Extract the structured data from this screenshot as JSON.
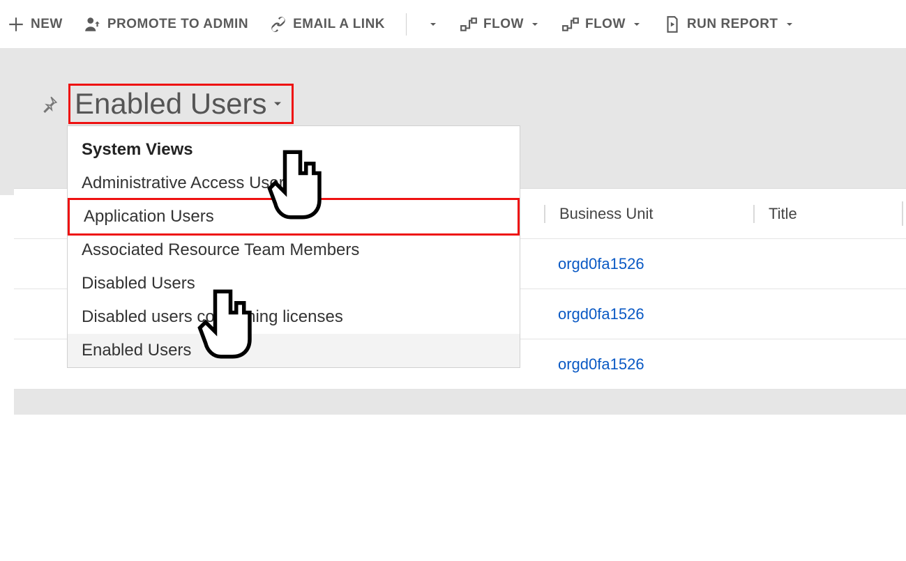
{
  "cmdbar": {
    "new": "NEW",
    "promote": "PROMOTE TO ADMIN",
    "email": "EMAIL A LINK",
    "flow1": "FLOW",
    "flow2": "FLOW",
    "run_report": "RUN REPORT"
  },
  "view": {
    "title": "Enabled Users"
  },
  "dropdown": {
    "section": "System Views",
    "items": [
      "Administrative Access Users",
      "Application Users",
      "Associated Resource Team Members",
      "Disabled Users",
      "Disabled users consuming licenses",
      "Enabled Users"
    ],
    "highlight_index": 1,
    "selected_index": 5
  },
  "grid": {
    "columns": {
      "bu": "Business Unit",
      "title": "Title"
    },
    "rows": [
      {
        "bu": "orgd0fa1526",
        "title": ""
      },
      {
        "bu": "orgd0fa1526",
        "title": ""
      },
      {
        "bu": "orgd0fa1526",
        "title": ""
      }
    ]
  }
}
